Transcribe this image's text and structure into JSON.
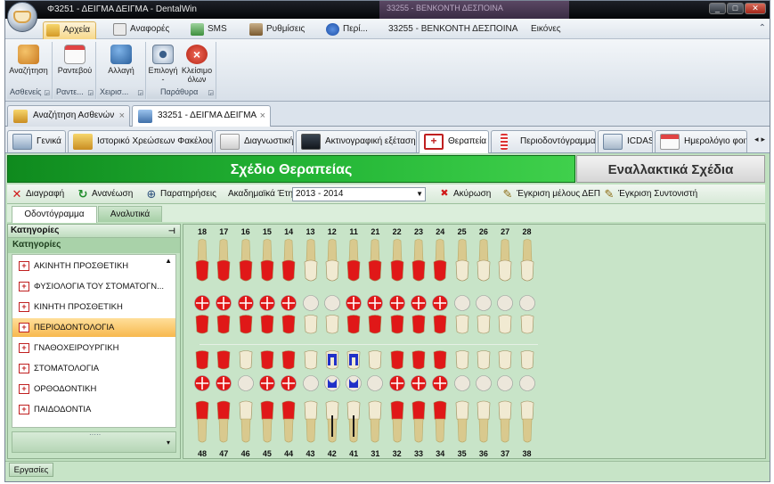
{
  "window": {
    "title": "Φ3251 - ΔΕΙΓΜΑ ΔΕΙΓΜΑ - DentalWin",
    "inactive_tab_title": "33255 - ΒΕΝΚΟΝΤΗ ΔΕΣΠΟΙΝΑ",
    "controls": [
      "_",
      "□",
      "✕"
    ]
  },
  "ribbon_tabs": [
    {
      "label": "Αρχεία",
      "icon": "folder-icon",
      "active": true
    },
    {
      "label": "Αναφορές",
      "icon": "report-icon",
      "active": false
    },
    {
      "label": "SMS",
      "icon": "sms-icon",
      "active": false
    },
    {
      "label": "Ρυθμίσεις",
      "icon": "tools-icon",
      "active": false
    },
    {
      "label": "Περί...",
      "icon": "info-icon",
      "active": false
    },
    {
      "label": "33255 - ΒΕΝΚΟΝΤΗ ΔΕΣΠΟΙΝΑ",
      "icon": "",
      "active": false
    },
    {
      "label": "Εικόνες",
      "icon": "",
      "active": false
    }
  ],
  "ribbon_groups": [
    {
      "label": "Ασθενείς",
      "buttons": [
        {
          "label": "Αναζήτηση",
          "icon": "patients-search-icon"
        }
      ]
    },
    {
      "label": "Ραντε...",
      "buttons": [
        {
          "label": "Ραντεβού",
          "icon": "calendar-icon"
        }
      ]
    },
    {
      "label": "Χειρισ...",
      "buttons": [
        {
          "label": "Αλλαγή",
          "icon": "user-change-icon"
        }
      ]
    },
    {
      "label": "Παράθυρα",
      "buttons": [
        {
          "label": "Επιλογή",
          "sub": "-",
          "icon": "eye-icon"
        },
        {
          "label": "Κλείσιμο",
          "sub": "όλων",
          "icon": "close-all-icon"
        }
      ]
    }
  ],
  "doc_tabs": [
    {
      "label": "Αναζήτηση Ασθενών",
      "active": false
    },
    {
      "label": "33251 - ΔΕΙΓΜΑ ΔΕΙΓΜΑ",
      "active": true
    }
  ],
  "section_tabs": [
    {
      "label": "Γενικά",
      "active": false
    },
    {
      "label": "Ιστορικό Χρεώσεων Φακέλου",
      "active": false
    },
    {
      "label": "Διαγνωστική",
      "active": false
    },
    {
      "label": "Ακτινογραφική εξέταση",
      "active": false
    },
    {
      "label": "Θεραπεία",
      "active": true
    },
    {
      "label": "Περιοδοντόγραμμα",
      "active": false
    },
    {
      "label": "ICDAS",
      "active": false
    },
    {
      "label": "Ημερολόγιο φοιτ",
      "active": false
    }
  ],
  "plan": {
    "title": "Σχέδιο Θεραπείας",
    "alt_title": "Εναλλακτικά Σχέδια"
  },
  "toolbar": {
    "delete": "Διαγραφή",
    "refresh": "Ανανέωση",
    "notes": "Παρατηρήσεις",
    "year_label": "Ακαδημαϊκά Έτη",
    "year_value": "2013 - 2014",
    "cancel": "Ακύρωση",
    "approve_member": "Έγκριση μέλους ΔΕΠ",
    "approve_coordinator": "Έγκριση Συντονιστή"
  },
  "sub_tabs": {
    "odontogram": "Οδοντόγραμμα",
    "analytic": "Αναλυτικά"
  },
  "categories": {
    "panel_title": "Κατηγορίες",
    "group_label": "Κατηγορίες",
    "items": [
      {
        "label": "ΑΚΙΝΗΤΗ ΠΡΟΣΘΕΤΙΚΗ",
        "selected": false
      },
      {
        "label": "ΦΥΣΙΟΛΟΓΙΑ ΤΟΥ ΣΤΟΜΑΤΟΓΝ...",
        "selected": false
      },
      {
        "label": "ΚΙΝΗΤΗ ΠΡΟΣΘΕΤΙΚΗ",
        "selected": false
      },
      {
        "label": "ΠΕΡΙΟΔΟΝΤΟΛΟΓΙΑ",
        "selected": true
      },
      {
        "label": "ΓΝΑΘΟΧΕΙΡΟΥΡΓΙΚΗ",
        "selected": false
      },
      {
        "label": "ΣΤΟΜΑΤΟΛΟΓΙΑ",
        "selected": false
      },
      {
        "label": "ΟΡΘΟΔΟΝΤΙΚΗ",
        "selected": false
      },
      {
        "label": "ΠΑΙΔΟΔΟΝΤΙΑ",
        "selected": false
      }
    ]
  },
  "odontogram": {
    "upper_numbers": [
      "18",
      "17",
      "16",
      "15",
      "14",
      "13",
      "12",
      "11",
      "21",
      "22",
      "23",
      "24",
      "25",
      "26",
      "27",
      "28"
    ],
    "lower_numbers": [
      "48",
      "47",
      "46",
      "45",
      "44",
      "43",
      "42",
      "41",
      "31",
      "32",
      "33",
      "34",
      "35",
      "36",
      "37",
      "38"
    ],
    "colors": {
      "treatment": "#e01818",
      "restoration": "#2030c8",
      "tooth": "#f1ead2",
      "root": "#d9c98e"
    },
    "upper_states": [
      "red",
      "red",
      "red",
      "red",
      "red",
      "none",
      "none",
      "red",
      "red",
      "red",
      "red",
      "red",
      "none",
      "none",
      "none",
      "none"
    ],
    "lower_states": [
      "red",
      "red",
      "none",
      "red",
      "red",
      "none",
      "blue",
      "blue",
      "none",
      "red",
      "red",
      "red",
      "none",
      "none",
      "none",
      "none"
    ]
  },
  "footer_tab": "Εργασίες"
}
